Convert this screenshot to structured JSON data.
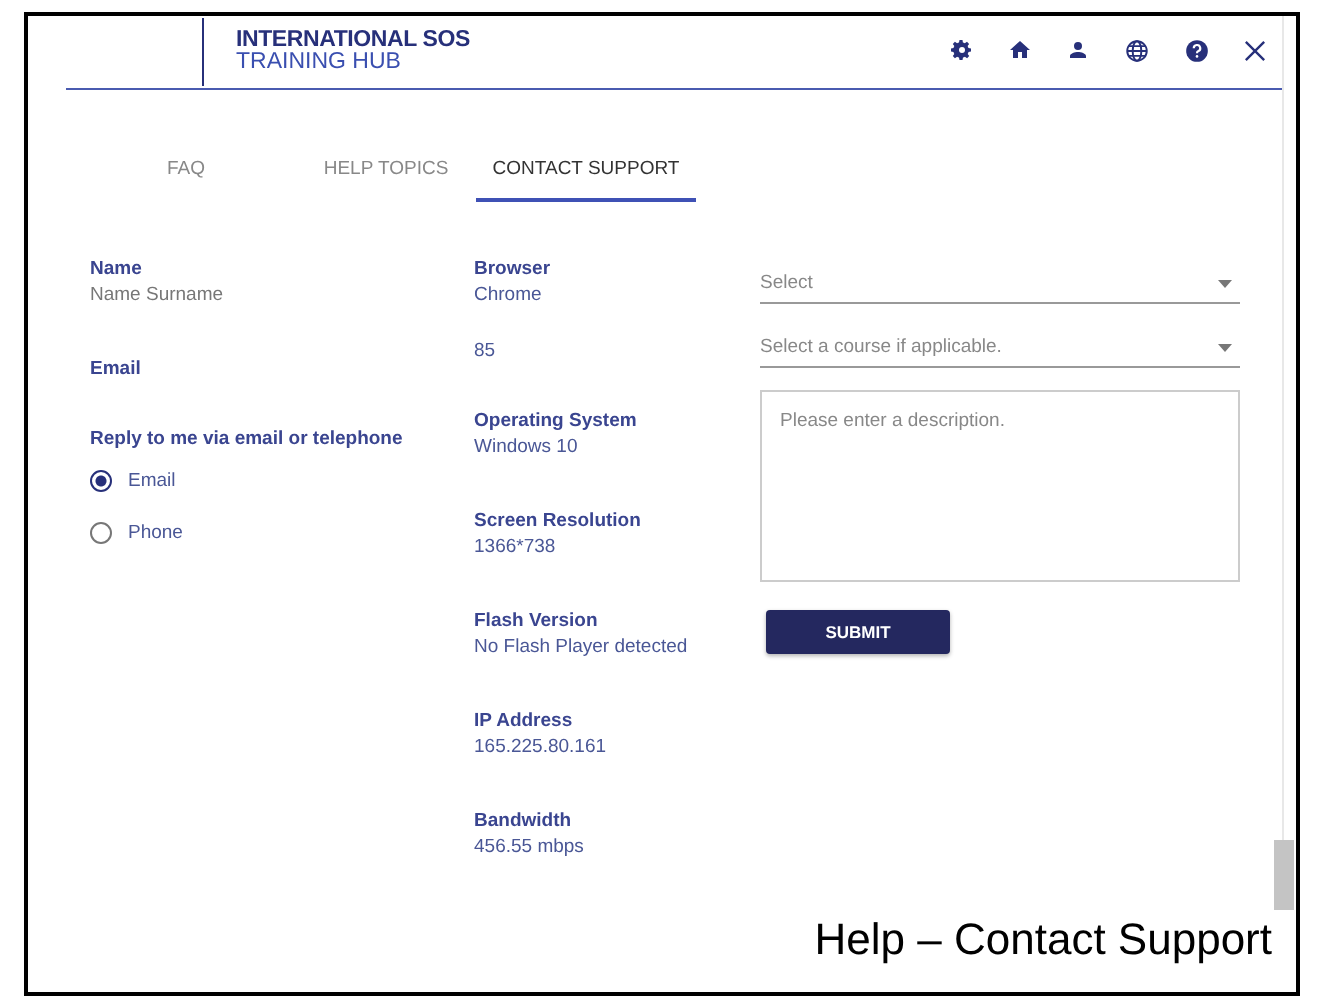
{
  "header": {
    "logo_line1": "INTERNATIONAL SOS",
    "logo_line2": "TRAINING HUB"
  },
  "tabs": [
    {
      "label": "FAQ",
      "selected": false
    },
    {
      "label": "HELP TOPICS",
      "selected": false
    },
    {
      "label": "CONTACT SUPPORT",
      "selected": true
    }
  ],
  "contact": {
    "name_label": "Name",
    "name_value": "Name Surname",
    "email_label": "Email",
    "reply_label": "Reply to me via email or telephone",
    "reply_options": [
      {
        "label": "Email",
        "selected": true
      },
      {
        "label": "Phone",
        "selected": false
      }
    ]
  },
  "system_info": [
    {
      "label": "Browser",
      "value": "Chrome"
    },
    {
      "value": "85"
    },
    {
      "label": "Operating System",
      "value": "Windows 10"
    },
    {
      "label": "Screen Resolution",
      "value": "1366*738"
    },
    {
      "label": "Flash Version",
      "value": "No Flash Player detected"
    },
    {
      "label": "IP Address",
      "value": "165.225.80.161"
    },
    {
      "label": "Bandwidth",
      "value": "456.55 mbps"
    }
  ],
  "form": {
    "selects": [
      {
        "placeholder": "Select"
      },
      {
        "placeholder": "Select a course if applicable."
      }
    ],
    "description_placeholder": "Please enter a description.",
    "submit": "SUBMIT"
  },
  "caption": "Help – Contact Support"
}
